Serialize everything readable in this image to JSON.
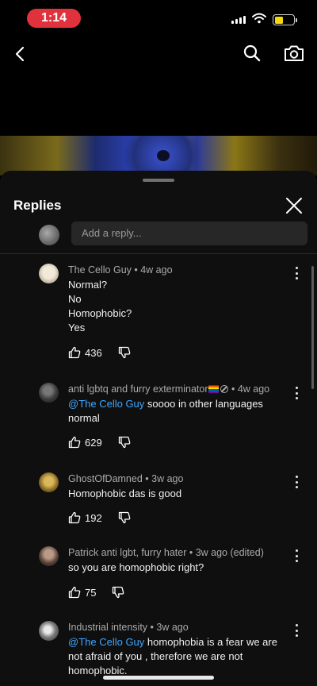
{
  "status_bar": {
    "time": "1:14",
    "accent": "#e0323c",
    "battery_color": "#f5d90a"
  },
  "top_nav": {
    "icons": [
      "back-icon",
      "search-icon",
      "camera-icon"
    ]
  },
  "sheet": {
    "title": "Replies",
    "reply_placeholder": "Add a reply..."
  },
  "comments": [
    {
      "author": "The Cello Guy",
      "time": "4w ago",
      "text": "Normal?\nNo\nHomophobic?\nYes",
      "likes": "436"
    },
    {
      "author": "anti lgbtq and furry exterminator",
      "time": "4w ago",
      "mention": "@The Cello Guy",
      "text": "soooo in other languages normal",
      "likes": "629"
    },
    {
      "author": "GhostOfDamned",
      "time": "3w ago",
      "text": "Homophobic das is good",
      "likes": "192"
    },
    {
      "author": "Patrick anti lgbt, furry hater",
      "time": "3w ago (edited)",
      "text": "so you are homophobic right?",
      "likes": "75"
    },
    {
      "author": "Industrial intensity",
      "time": "3w ago",
      "mention": "@The Cello Guy",
      "text": "homophobia is a fear we are not afraid of you , therefore we are not homophobic."
    }
  ],
  "colors": {
    "mention": "#3ea6ff",
    "sheet_bg": "#0f0f0f",
    "input_bg": "#272727"
  }
}
